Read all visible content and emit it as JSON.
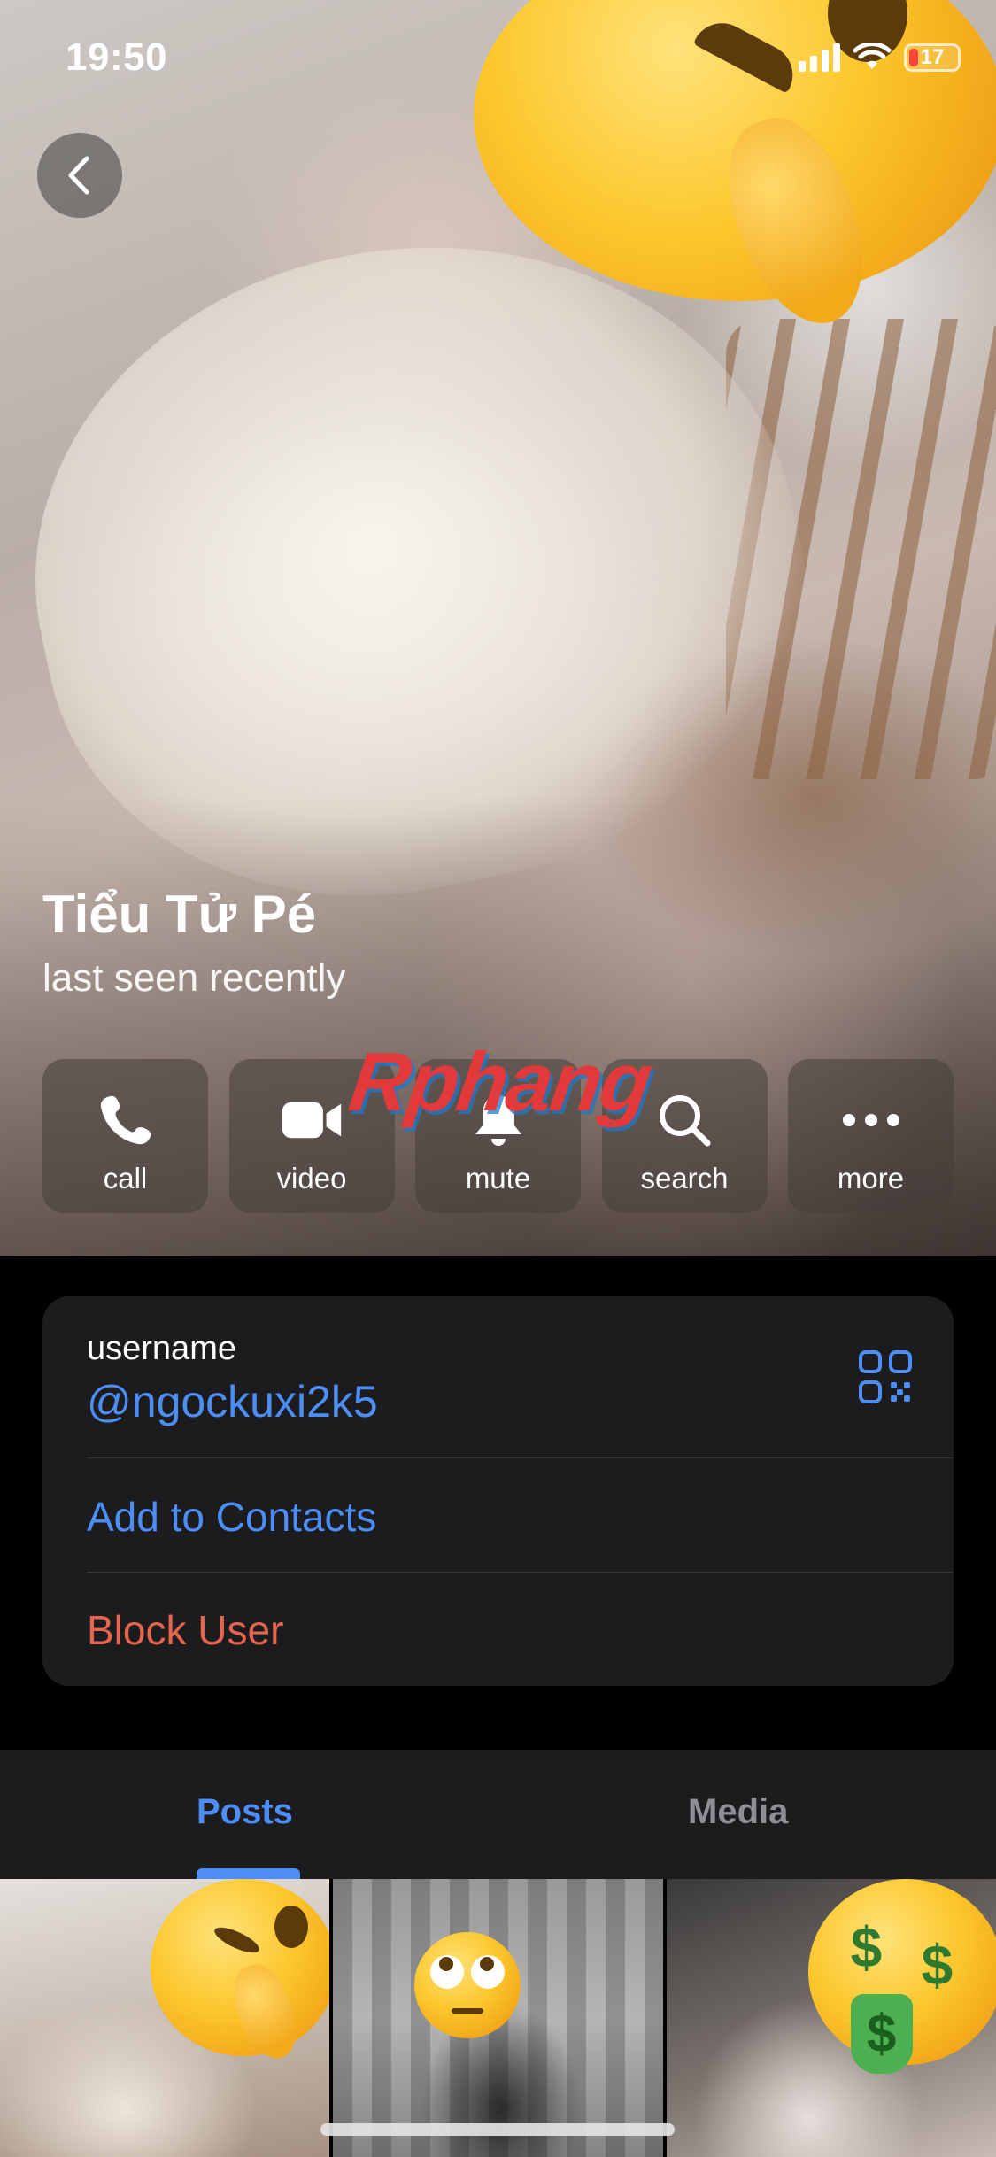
{
  "status_bar": {
    "time": "19:50",
    "battery": "17",
    "battery_color": "#ff453a"
  },
  "profile": {
    "name": "Tiểu Tử Pé",
    "status": "last seen recently"
  },
  "watermark": "Rphang",
  "actions": [
    {
      "label": "call",
      "icon": "phone-icon"
    },
    {
      "label": "video",
      "icon": "video-camera-icon"
    },
    {
      "label": "mute",
      "icon": "bell-icon"
    },
    {
      "label": "search",
      "icon": "search-icon"
    },
    {
      "label": "more",
      "icon": "more-dots-icon"
    }
  ],
  "info": {
    "username_label": "username",
    "username_value": "@ngockuxi2k5",
    "add_contacts": "Add to Contacts",
    "block_user": "Block User"
  },
  "tabs": [
    {
      "label": "Posts",
      "active": true
    },
    {
      "label": "Media",
      "active": false
    }
  ],
  "colors": {
    "accent": "#4d8ef6",
    "danger": "#e5654e",
    "card_bg": "#1c1c1e"
  }
}
